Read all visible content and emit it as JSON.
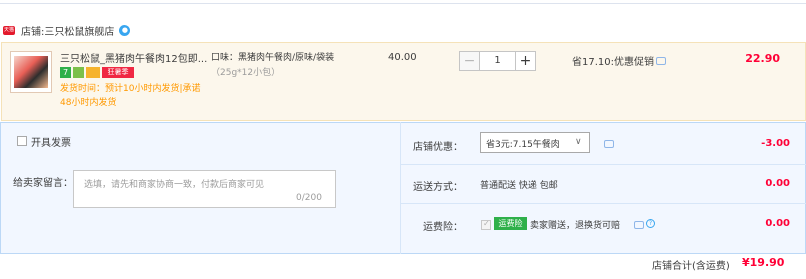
{
  "store": {
    "prefix": "店铺:",
    "name": "三只松鼠旗舰店",
    "badge_text": "天猫"
  },
  "item": {
    "title": "三只松鼠_黑猪肉午餐肉12包即...",
    "badge_seven": "7",
    "badge_sale": "狂暑季",
    "ship_note": "发货时间：预计10小时内发货|承诺48小时内发货",
    "attr_line1": "口味：黑猪肉午餐肉/原味/袋装",
    "attr_line2": "（25g*12小包）",
    "unit_price": "40.00",
    "quantity": "1",
    "minus": "−",
    "plus": "+",
    "promo": "省17.10:优惠促销",
    "subtotal": "22.90"
  },
  "options": {
    "invoice_label": "开具发票",
    "message_label": "给卖家留言：",
    "message_placeholder": "选填，请先和商家协商一致，付款后商家可见",
    "message_count": "0/200",
    "coupon_label": "店铺优惠：",
    "coupon_value": "省3元:7.15午餐肉",
    "coupon_amount": "-3.00",
    "shipping_label": "运送方式：",
    "shipping_value": "普通配送 快递 包邮",
    "shipping_amount": "0.00",
    "insurance_label": "运费险：",
    "insurance_badge": "运费险",
    "insurance_text": "卖家赠送，退换货可赔",
    "insurance_amount": "0.00"
  },
  "total": {
    "label": "店铺合计(含运费)",
    "value": "¥19.90"
  },
  "colors": {
    "price_red": "#ff0036",
    "ship_orange": "#ff9900",
    "panel_blue": "#f2f7ff",
    "item_bg": "#fcf7ec"
  }
}
